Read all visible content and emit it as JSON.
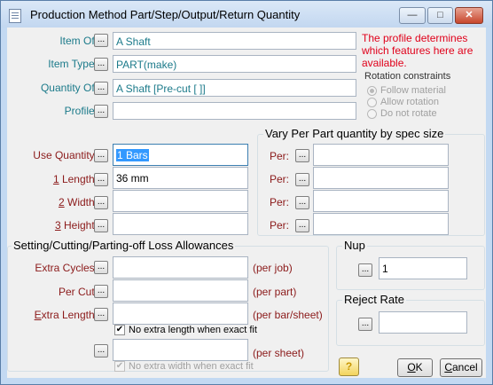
{
  "window": {
    "title": "Production Method Part/Step/Output/Return Quantity",
    "minimize_glyph": "—",
    "maximize_glyph": "□",
    "close_glyph": "✕"
  },
  "dots_glyph": "...",
  "top": {
    "item_of": {
      "label": "Item Of:",
      "value": "A Shaft"
    },
    "item_type": {
      "label": "Item Type:",
      "value": "PART(make)"
    },
    "quantity_of": {
      "label": "Quantity Of:",
      "value": "A Shaft [Pre-cut [ ]]"
    },
    "profile": {
      "label": "Profile:",
      "value": ""
    },
    "notice": "The profile determines which features here are available."
  },
  "rotation": {
    "title": "Rotation constraints",
    "options": [
      "Follow material",
      "Allow rotation",
      "Do not rotate"
    ],
    "selected": "Follow material"
  },
  "quantity": {
    "use_quantity": {
      "label": "Use Quantity:",
      "value": "1 Bars"
    },
    "length": {
      "key": "1",
      "rest": " Length:",
      "value": "36 mm"
    },
    "width": {
      "key": "2",
      "rest": " Width:",
      "value": ""
    },
    "height": {
      "key": "3",
      "rest": " Height:",
      "value": ""
    }
  },
  "vary": {
    "title": "Vary Per Part quantity by spec size",
    "per_label": "Per:",
    "rows": [
      "",
      "",
      "",
      ""
    ]
  },
  "loss": {
    "title": "Setting/Cutting/Parting-off Loss Allowances",
    "extra_cycles": {
      "label": "Extra Cycles:",
      "value": "",
      "unit": "(per job)"
    },
    "per_cut": {
      "label": "Per Cut:",
      "value": "",
      "unit": "(per part)"
    },
    "extra_length": {
      "key": "E",
      "rest": "xtra Length:",
      "value": "",
      "unit": "(per bar/sheet)"
    },
    "no_extra_length": {
      "label": "No extra length when exact fit",
      "checked": true
    },
    "per_sheet": {
      "value": "",
      "unit": "(per sheet)"
    },
    "no_extra_width": {
      "label": "No extra width when exact fit",
      "checked": true
    }
  },
  "nup": {
    "title": "Nup",
    "value": "1"
  },
  "reject": {
    "title": "Reject Rate",
    "value": ""
  },
  "buttons": {
    "help_glyph": "?",
    "ok_key": "O",
    "ok_rest": "K",
    "cancel_key": "C",
    "cancel_rest": "ancel"
  },
  "colors": {
    "label_teal": "#1b7a8a",
    "label_maroon": "#8b1a1a",
    "notice_red": "#e0001a",
    "selection": "#3399ff"
  }
}
